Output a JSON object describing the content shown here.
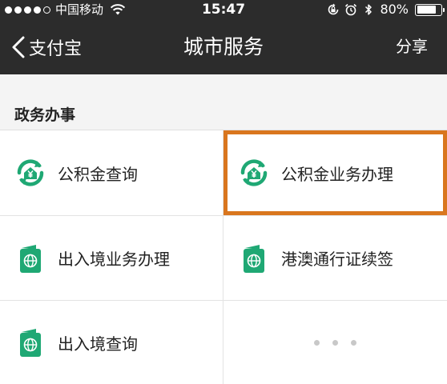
{
  "status_bar": {
    "carrier": "中国移动",
    "time": "15:47",
    "battery_percent": "80%",
    "battery_level": 0.8,
    "signal_icon": "signal-dots-icon",
    "wifi_icon": "wifi-icon",
    "rotation_lock_icon": "rotation-lock-icon",
    "alarm_icon": "alarm-icon",
    "bluetooth_icon": "bluetooth-icon"
  },
  "nav": {
    "back_label": "支付宝",
    "title": "城市服务",
    "share_label": "分享"
  },
  "section": {
    "title": "政务办事"
  },
  "services": [
    {
      "label": "公积金查询",
      "icon": "housing-fund-icon"
    },
    {
      "label": "公积金业务办理",
      "icon": "housing-fund-icon",
      "highlighted": true
    },
    {
      "label": "出入境业务办理",
      "icon": "passport-icon"
    },
    {
      "label": "港澳通行证续签",
      "icon": "passport-icon"
    },
    {
      "label": "出入境查询",
      "icon": "passport-icon"
    }
  ],
  "more_icon": "more-dots-icon",
  "colors": {
    "header_bg": "#2c2c2c",
    "icon_green": "#1fa874",
    "highlight_orange": "#d9761e"
  }
}
